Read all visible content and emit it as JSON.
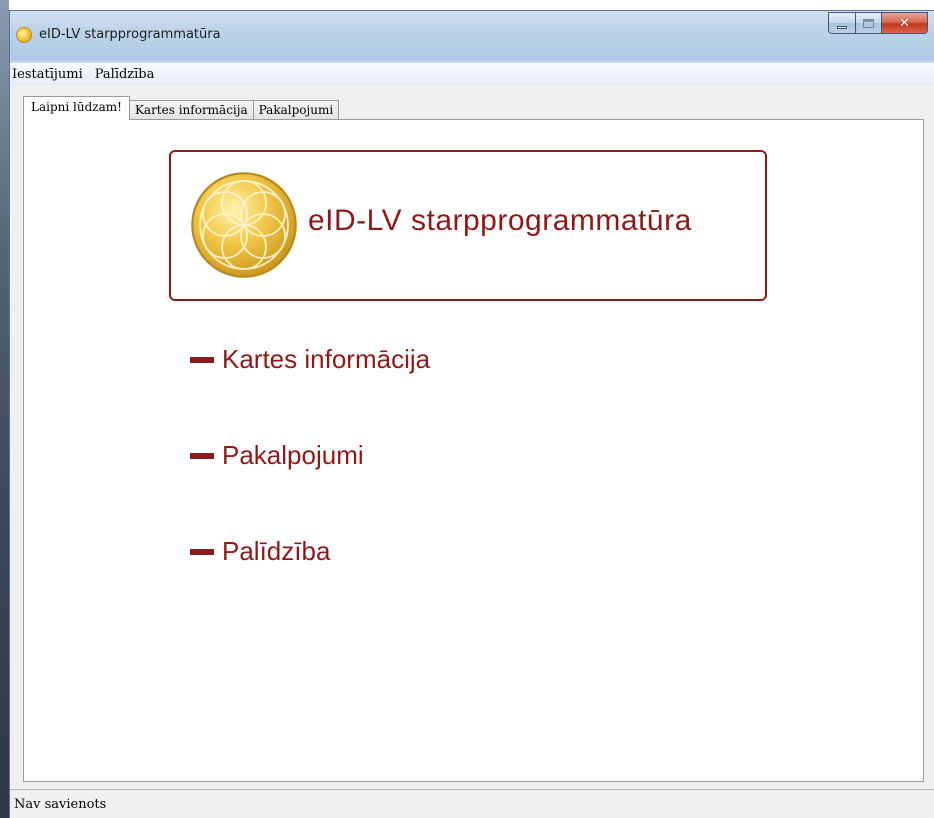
{
  "window": {
    "title": "eID-LV starpprogrammatūra",
    "icon": "app-coin-icon",
    "buttons": {
      "minimize": "minimize-icon",
      "maximize": "maximize-icon",
      "close": "close-icon"
    }
  },
  "menubar": {
    "items": [
      "Iestatījumi",
      "Palīdzība"
    ]
  },
  "tabs": [
    {
      "label": "Laipni lūdzam!",
      "active": true
    },
    {
      "label": "Kartes informācija",
      "active": false
    },
    {
      "label": "Pakalpojumi",
      "active": false
    }
  ],
  "banner": {
    "title": "eID-LV starpprogrammatūra",
    "logo": "flower-of-life-logo"
  },
  "links": [
    {
      "label": "Kartes informācija",
      "icon": "dash-icon"
    },
    {
      "label": "Pakalpojumi",
      "icon": "dash-icon"
    },
    {
      "label": "Palīdzība",
      "icon": "dash-icon"
    }
  ],
  "statusbar": {
    "text": "Nav savienots"
  },
  "colors": {
    "accent": "#8b1a1a",
    "logo_gold": "#e6b53a"
  }
}
